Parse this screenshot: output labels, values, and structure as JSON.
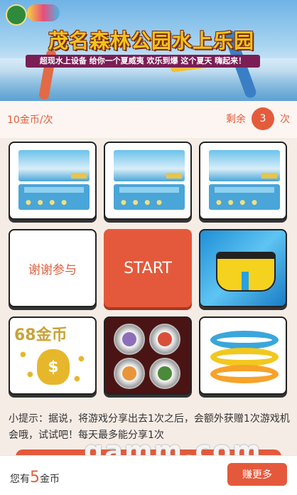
{
  "banner": {
    "title": "茂名森林公园水上乐园",
    "subtitle": "超现水上设备 给你一个夏威夷 欢乐到爆 这个夏天 嗨起来！"
  },
  "game": {
    "cost_label": "10金币/次",
    "remaining_prefix": "剩余",
    "remaining_count": "3",
    "remaining_suffix": "次"
  },
  "prizes": {
    "thanks_label": "谢谢参与",
    "start_label": "START",
    "coins_label": "68金币",
    "coins_bag_symbol": "$"
  },
  "tip": {
    "text": "小提示：据说，将游戏分享出去1次之后，会额外获赠1次游戏机会哦，试试吧！每天最多能分享1次"
  },
  "watermark": "gamm.com",
  "footer": {
    "have_prefix": "您有",
    "coins": "5",
    "have_suffix": "金币",
    "earn_button": "赚更多"
  },
  "colors": {
    "accent": "#e4593b",
    "text_accent": "#e0603c",
    "background": "#f6ece6"
  }
}
